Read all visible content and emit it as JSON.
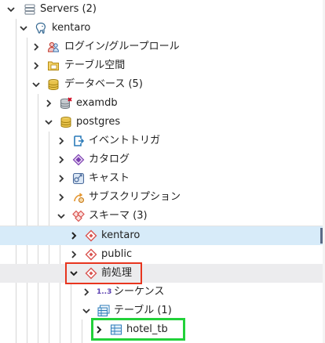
{
  "tree": {
    "servers": {
      "label": "Servers (2)",
      "icon": "servers-icon",
      "expanded": true
    },
    "kentaro_server": {
      "label": "kentaro",
      "icon": "postgresql-elephant-icon",
      "expanded": true
    },
    "login_roles": {
      "label": "ログイン/グループロール",
      "icon": "login-roles-icon",
      "expanded": false
    },
    "tablespaces": {
      "label": "テーブル空間",
      "icon": "tablespace-icon",
      "expanded": false
    },
    "databases": {
      "label": "データベース (5)",
      "icon": "database-icon",
      "expanded": true
    },
    "examdb": {
      "label": "examdb",
      "icon": "database-disconnected-icon",
      "expanded": false
    },
    "postgres_db": {
      "label": "postgres",
      "icon": "database-icon",
      "expanded": true
    },
    "event_triggers": {
      "label": "イベントトリガ",
      "icon": "event-trigger-icon",
      "expanded": false
    },
    "catalogs": {
      "label": "カタログ",
      "icon": "catalog-icon",
      "expanded": false
    },
    "casts": {
      "label": "キャスト",
      "icon": "cast-icon",
      "expanded": false
    },
    "subscriptions": {
      "label": "サブスクリプション",
      "icon": "subscription-icon",
      "expanded": false
    },
    "schemas": {
      "label": "スキーマ (3)",
      "icon": "schemas-icon",
      "expanded": true
    },
    "schema_kentaro": {
      "label": "kentaro",
      "icon": "schema-icon",
      "expanded": false,
      "selected": true
    },
    "schema_public": {
      "label": "public",
      "icon": "schema-icon",
      "expanded": false
    },
    "schema_preprocess": {
      "label": "前処理",
      "icon": "schema-icon",
      "expanded": true,
      "highlight": "red"
    },
    "sequences": {
      "label": "シーケンス",
      "icon": "sequence-icon",
      "icon_text": "1..3",
      "expanded": false
    },
    "tables": {
      "label": "テーブル (1)",
      "icon": "tables-icon",
      "expanded": true
    },
    "hotel_tb": {
      "label": "hotel_tb",
      "icon": "table-icon",
      "expanded": false,
      "highlight": "green"
    }
  },
  "colors": {
    "selected_row": "#d7ebf9",
    "hover_row": "#ececee",
    "red_box": "#e8351e",
    "green_box": "#22d13a",
    "schema_icon": "#d9534f",
    "db_icon": "#c9a227"
  }
}
